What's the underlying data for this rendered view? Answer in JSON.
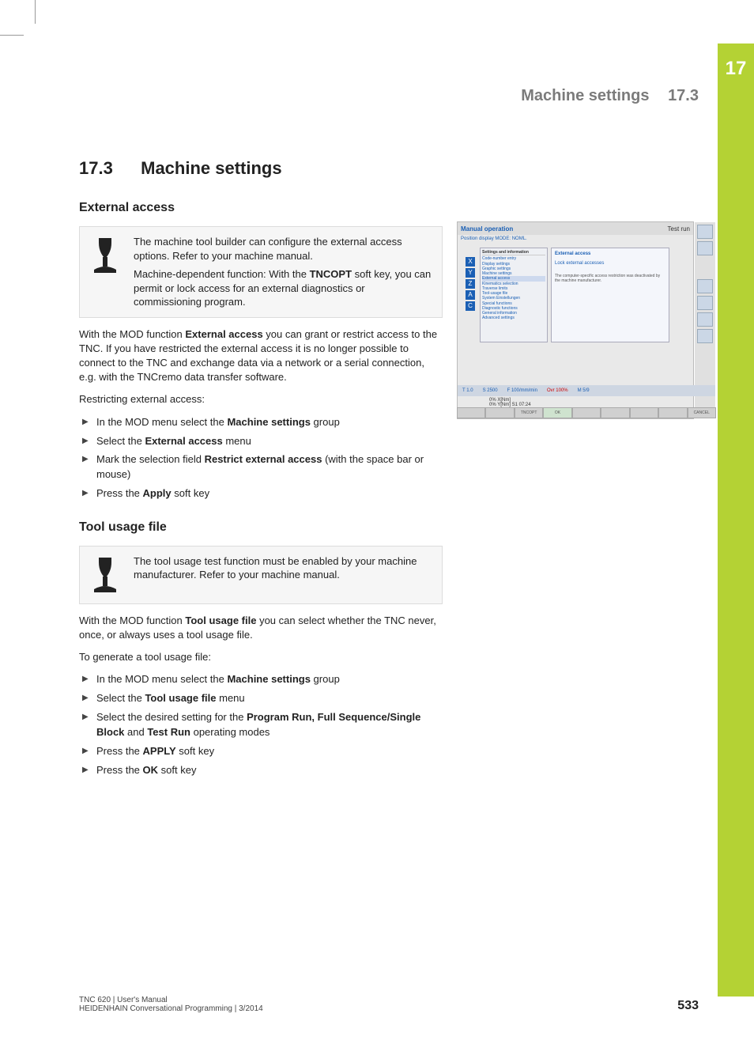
{
  "chapterTabNumber": "17",
  "runningHead": {
    "title": "Machine settings",
    "section": "17.3"
  },
  "sectionTitle": {
    "num": "17.3",
    "text": "Machine settings"
  },
  "externalAccess": {
    "heading": "External access",
    "noteP1": "The machine tool builder can configure the external access options. Refer to your machine manual.",
    "noteP2a": "Machine-dependent function: With the ",
    "noteP2b": "TNCOPT",
    "noteP2c": " soft key, you can permit or lock access for an external diagnostics or commissioning program.",
    "para1a": "With the MOD function ",
    "para1b": "External access",
    "para1c": " you can grant or restrict access to the TNC. If you have restricted the external access it is no longer possible to connect to the TNC and exchange data via a network or a serial connection, e.g. with the TNCremo data transfer software.",
    "para2": "Restricting external access:",
    "step1a": "In the MOD menu select the ",
    "step1b": "Machine settings",
    "step1c": " group",
    "step2a": "Select the ",
    "step2b": "External access",
    "step2c": " menu",
    "step3a": "Mark the selection field ",
    "step3b": "Restrict external access",
    "step3c": " (with the space bar or mouse)",
    "step4a": "Press the ",
    "step4b": "Apply",
    "step4c": " soft key"
  },
  "toolUsage": {
    "heading": "Tool usage file",
    "note": "The tool usage test function must be enabled by your machine manufacturer. Refer to your machine manual.",
    "para1a": "With the MOD function ",
    "para1b": "Tool usage file",
    "para1c": " you can select whether the TNC never, once, or always uses a tool usage file.",
    "para2": "To generate a tool usage file:",
    "step1a": "In the MOD menu select the ",
    "step1b": "Machine settings",
    "step1c": " group",
    "step2a": "Select the ",
    "step2b": "Tool usage file",
    "step2c": " menu",
    "step3a": "Select the desired setting for the ",
    "step3b": "Program Run, Full Sequence/Single Block",
    "step3c": " and ",
    "step3d": "Test Run",
    "step3e": " operating modes",
    "step4a": "Press the ",
    "step4b": "APPLY",
    "step4c": " soft key",
    "step5a": "Press the ",
    "step5b": "OK",
    "step5c": " soft key"
  },
  "screenshot": {
    "modeLeft": "Manual operation",
    "modeSub": "Manual operation",
    "modeRight": "Test run",
    "posDisplay": "Position display MODE: NOML.",
    "axes": [
      "X",
      "Y",
      "Z",
      "A",
      "C"
    ],
    "treeHeader": "Settings and information",
    "treeItems": [
      "Code-number entry",
      "Display settings",
      "Graphic settings",
      "Machine settings",
      "  External access",
      "  Kinematics selection",
      "  Traverse limits",
      "  Tool-usage file",
      "System Einstellungen",
      "Special functions",
      "Diagnostic functions",
      "General information",
      "Advanced settings"
    ],
    "panelTitle": "External access",
    "panelLock": "Lock external accesses",
    "panelNote": "The computer-specific access restriction was deactivated by the machine manufacturer.",
    "status": {
      "t": "T 1.0",
      "s": "S 2500",
      "f": "F 100/mm/min",
      "ovr": "Ovr 100%",
      "m": "M 5/9"
    },
    "feed1": "0% X[Nm]",
    "feed2": "0% Y[Nm]  S1   07:24",
    "softkeys": [
      "",
      "",
      "TNCOPT",
      "OK",
      "",
      "",
      "",
      "",
      "CANCEL"
    ]
  },
  "footer": {
    "line1": "TNC 620 | User's Manual",
    "line2": "HEIDENHAIN Conversational Programming | 3/2014",
    "pageNumber": "533"
  }
}
